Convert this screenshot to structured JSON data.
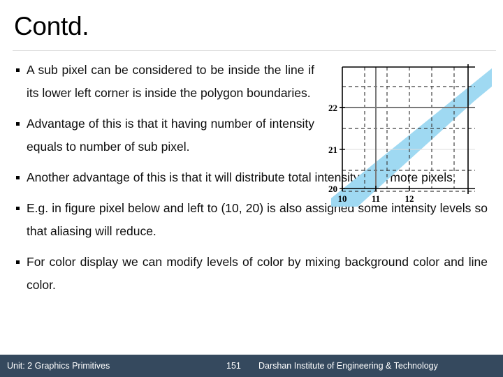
{
  "slide": {
    "title": "Contd."
  },
  "bullets": [
    {
      "marker": "square-bullet",
      "text": "A sub pixel can be considered to be inside the line if its lower left corner is inside the polygon boundaries.",
      "width": "narrow"
    },
    {
      "marker": "square-bullet",
      "text": "Advantage of this is that it having number of intensity equals to number of sub pixel.",
      "width": "narrow"
    },
    {
      "marker": "square-bullet",
      "text": "Another advantage of this is that it will distribute total intensity over more pixels.",
      "width": "wide"
    },
    {
      "marker": "square-bullet",
      "text": "E.g. in figure pixel below and left to (10, 20) is also assigned some intensity levels so that aliasing will reduce.",
      "width": "wide"
    },
    {
      "marker": "square-bullet",
      "text": "For color display we can modify levels of color by mixing background color and line color.",
      "width": "wide"
    }
  ],
  "figure": {
    "name": "antialiasing-subpixel-grid-diagram",
    "x_ticks": [
      "10",
      "11",
      "12"
    ],
    "y_ticks": [
      "20",
      "21",
      "22"
    ],
    "band_color": "#9fd9f2",
    "grid_dash_color": "#3f3f3f",
    "axis_color": "#000000",
    "major_line_color": "#6e6e6e"
  },
  "footer": {
    "unit": "Unit: 2 Graphics Primitives",
    "page": "151",
    "institute": "Darshan Institute of Engineering & Technology",
    "bar_color": "#35495e"
  }
}
